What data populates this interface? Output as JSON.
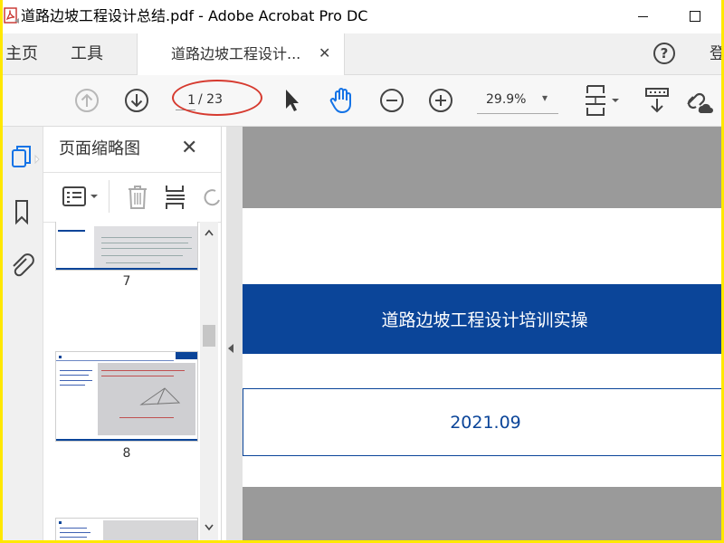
{
  "window": {
    "title": "道路边坡工程设计总结.pdf - Adobe Acrobat Pro DC",
    "app_icon": "acrobat-pdf-icon"
  },
  "tabs": {
    "home": "主页",
    "tools": "工具",
    "document": "道路边坡工程设计...",
    "help_icon": "?",
    "signin": "登"
  },
  "toolbar": {
    "page_current": "1",
    "page_total": "/ 23",
    "zoom": "29.9%",
    "zoom_caret": "▾",
    "icons": [
      "arrow-up-circle-icon",
      "arrow-down-circle-icon",
      "cursor-arrow-icon",
      "hand-icon",
      "zoom-out-icon",
      "zoom-in-icon",
      "fit-page-icon",
      "comment-icon",
      "link-cloud-icon"
    ]
  },
  "annotation": {
    "color": "#d63a2f"
  },
  "thumbnails_panel": {
    "title": "页面缩略图",
    "close": "✕",
    "thumbnails": [
      {
        "label": "7"
      },
      {
        "label": "8"
      },
      {
        "label": ""
      }
    ]
  },
  "document": {
    "banner_title": "道路边坡工程设计培训实操",
    "date": "2021.09",
    "accent_color": "#0b4599",
    "band_color": "#9a9a9a"
  }
}
